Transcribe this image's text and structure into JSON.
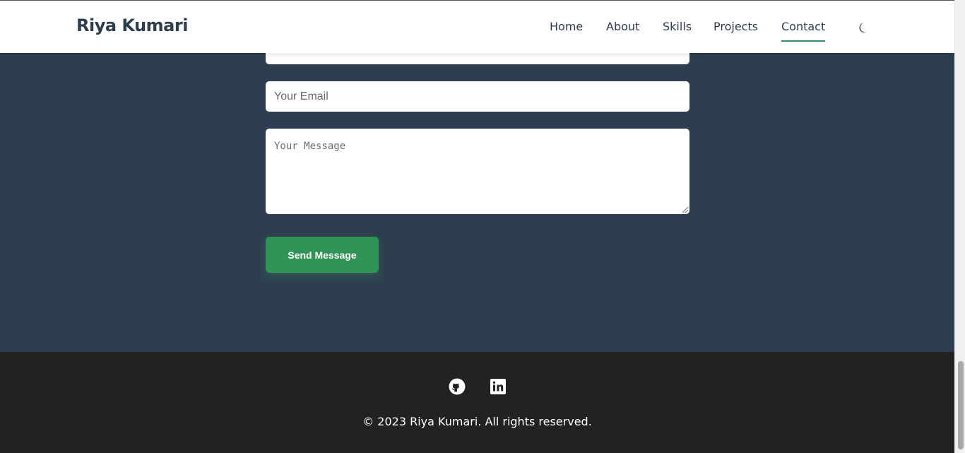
{
  "header": {
    "brand": "Riya Kumari",
    "nav": [
      {
        "label": "Home"
      },
      {
        "label": "About"
      },
      {
        "label": "Skills"
      },
      {
        "label": "Projects"
      },
      {
        "label": "Contact",
        "active": true
      }
    ],
    "theme_toggle_icon": "moon-icon"
  },
  "contact_form": {
    "name_placeholder": "",
    "email_placeholder": "Your Email",
    "message_placeholder": "Your Message",
    "submit_label": "Send Message"
  },
  "footer": {
    "social": [
      {
        "icon": "github-icon"
      },
      {
        "icon": "linkedin-icon"
      }
    ],
    "copyright": "© 2023 Riya Kumari. All rights reserved."
  },
  "colors": {
    "section_bg": "#2e3e50",
    "accent": "#2f9455",
    "footer_bg": "#222222",
    "header_bg": "#ffffff",
    "text_dark": "#2c3e50"
  }
}
